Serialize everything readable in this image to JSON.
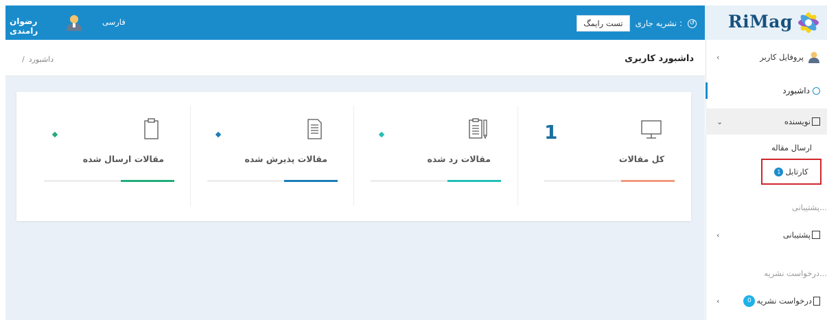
{
  "topbar": {
    "logo_text": "RiMag",
    "journal_label": "نشریه جاری :",
    "journal_value": "تست رایمگ",
    "username": "رضوان رامندی",
    "language": "فارسی"
  },
  "sidebar": {
    "profile": "پروفایل کاربر",
    "dashboard": "داشبورد",
    "writer": "نویسنده",
    "submit_article": "ارسال مقاله",
    "kartable": "کارتابل",
    "kartable_badge": "1",
    "support_section": "پشتیبانی...",
    "support": "پشتیبانی",
    "request_section": "درخواست نشریه...",
    "request": "درخواست نشریه",
    "request_badge": "0"
  },
  "header": {
    "title": "داشبورد کاربری",
    "breadcrumb": "داشبورد",
    "breadcrumb_sep": "/"
  },
  "stats": [
    {
      "title": "کل مقالات",
      "count": "1",
      "color": "#f19a7e",
      "icon": "monitor-icon"
    },
    {
      "title": "مقالات رد شده",
      "count": "",
      "color": "#22bfb5",
      "icon": "clipboard-edit-icon"
    },
    {
      "title": "مقالات پذیرش شده",
      "count": "",
      "color": "#1a7db5",
      "icon": "document-icon"
    },
    {
      "title": "مقالات ارسال شده",
      "count": "",
      "color": "#21ad7a",
      "icon": "clipboard-icon"
    }
  ],
  "colors": {
    "primary": "#1a8ccc",
    "highlight": "#d0262e"
  }
}
